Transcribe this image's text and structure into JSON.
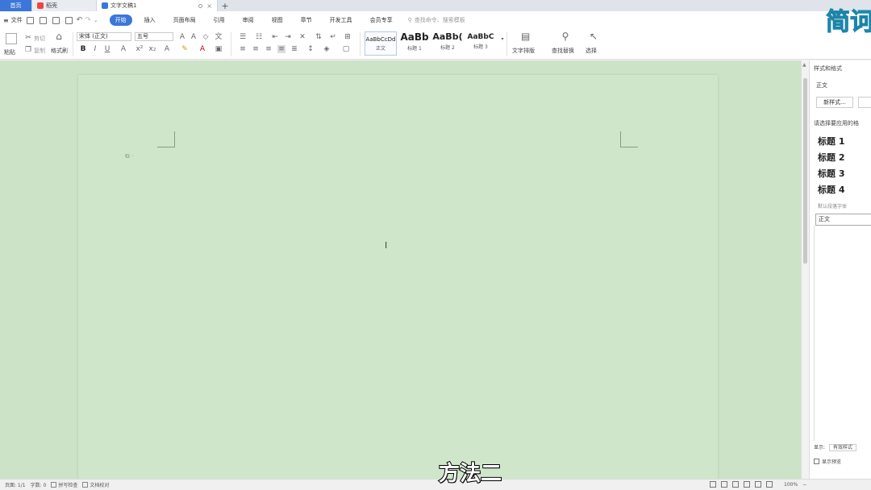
{
  "tabs": {
    "home": "首页",
    "wps": "稻壳",
    "doc": "文字文稿1",
    "add": "+"
  },
  "menubar": {
    "file": "文件",
    "items": [
      "开始",
      "插入",
      "页面布局",
      "引用",
      "审阅",
      "视图",
      "章节",
      "开发工具",
      "会员专享"
    ],
    "active_index": 0,
    "search_placeholder": "查找命令、搜索模板"
  },
  "ribbon": {
    "paste": "粘贴",
    "cut": "剪切",
    "copy": "复制",
    "format_painter": "格式刷",
    "font_name": "宋体 (正文)",
    "font_size": "五号",
    "styles": [
      {
        "sample": "AaBbCcDd",
        "label": "正文"
      },
      {
        "sample": "AaBb",
        "label": "标题 1"
      },
      {
        "sample": "AaBb(",
        "label": "标题 2"
      },
      {
        "sample": "AaBbC",
        "label": "标题 3"
      }
    ],
    "text_tools": "文字排版",
    "find_replace": "查找替换",
    "select": "选择"
  },
  "rpanel": {
    "title": "样式和格式",
    "current": "正文",
    "new_style": "新样式...",
    "sub": "请选择要应用的格",
    "headings": [
      "标题 1",
      "标题 2",
      "标题 3",
      "标题 4"
    ],
    "note": "默认段落字体",
    "selected": "正文",
    "display": "显示:",
    "display_value": "有效样式",
    "preview": "显示预览"
  },
  "document": {
    "caption": "方法二"
  },
  "status": {
    "page": "页面: 1/1",
    "words": "字数: 0",
    "spell": "拼写检查",
    "proof": "文档校对",
    "zoom": "100%"
  },
  "brand": {
    "text": "简诃"
  },
  "colors": {
    "accent": "#3b76d8",
    "workspace": "#cde3c8",
    "page": "#cfe6cb"
  }
}
